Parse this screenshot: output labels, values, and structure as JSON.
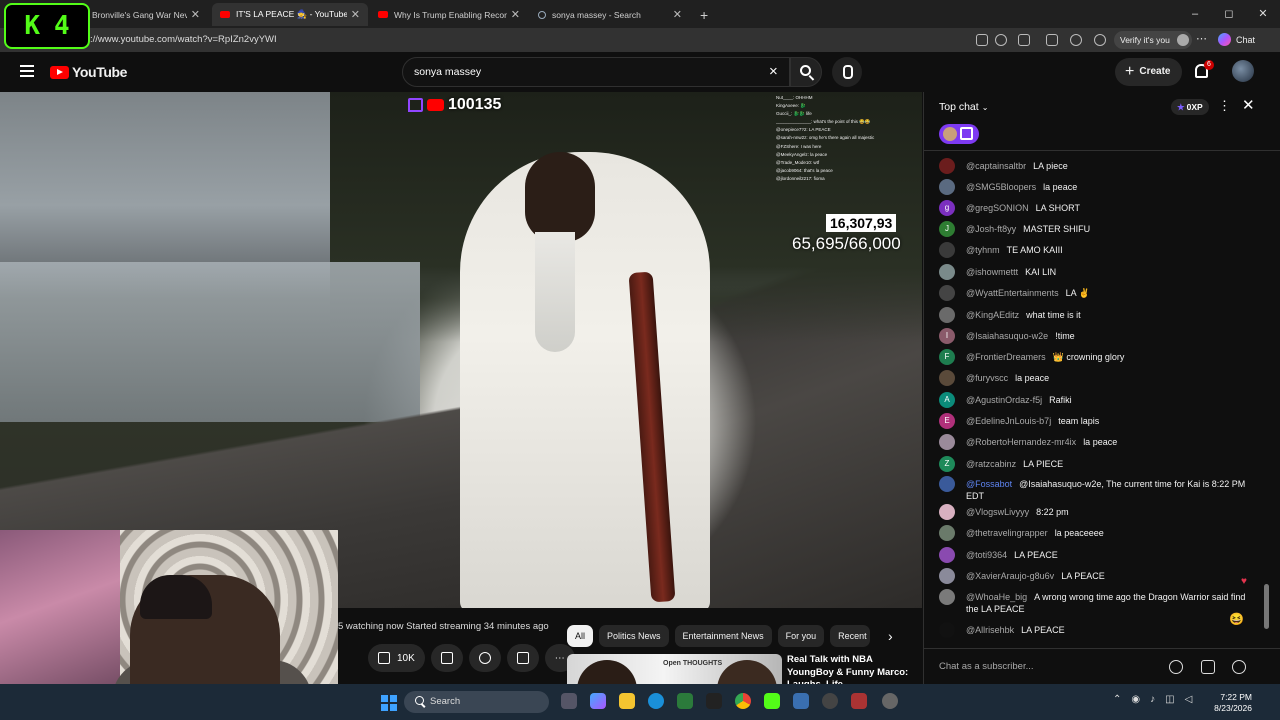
{
  "browser": {
    "kick_overlay": {
      "logo_letter": "K",
      "count": "4"
    },
    "tabs": [
      {
        "title": "Bronville's Gang War Never End",
        "kind": "tab"
      },
      {
        "title": "IT'S LA PEACE 🧙 - YouTube",
        "kind": "youtube",
        "active": true
      },
      {
        "title": "Why Is Trump Enabling Record Nu",
        "kind": "youtube"
      },
      {
        "title": "sonya massey - Search",
        "kind": "search"
      }
    ],
    "url": "://www.youtube.com/watch?v=RpIZn2vyYWI",
    "verify_label": "Verify it's you",
    "chat_label": "Chat",
    "window_controls": {
      "minimize": "–",
      "maximize": "◻",
      "close": "✕"
    }
  },
  "youtube": {
    "logo_text": "YouTube",
    "search": {
      "value": "sonya massey",
      "clear_icon": "×"
    },
    "create_label": "Create",
    "notification_count": "6"
  },
  "video": {
    "live_viewers": "100135",
    "overlay_chat": [
      "Nut____: OHHHM",
      "KingAxeee: 🐉",
      "Guccii_: 🐉🐉 life",
      "______________: what's the point of this 😂😂",
      "@onepiece7?2: LA PEACE",
      "@sarah-nnw2z: omg he's there again all majestic",
      "@FZShere: I was here",
      "@MeekyAngelz: la peace",
      "@Trade_Mode10: wtf",
      "@jacob9064: that's la peace",
      "@jlordonneil2217: fioma"
    ],
    "subscriber_count": "16,307,93",
    "goal_text": "65,695/66,000"
  },
  "below_video": {
    "stream_info": "5 watching now  Started streaming 34 minutes ago",
    "like_count": "10K",
    "chips": [
      {
        "label": "All",
        "active": true
      },
      {
        "label": "Politics News"
      },
      {
        "label": "Entertainment News"
      },
      {
        "label": "For you"
      },
      {
        "label": "Recent"
      }
    ],
    "chip_next": "›",
    "recommended": {
      "thumb_text": "Open THOUGHTS",
      "title": "Real Talk with NBA YoungBoy & Funny Marco: Laughs, Life, …"
    }
  },
  "chat": {
    "header": "Top chat",
    "xp_label": "0XP",
    "input_placeholder": "Chat as a subscriber...",
    "messages": [
      {
        "author": "@captainsaltbr",
        "text": "LA piece",
        "avatar": "",
        "color": "#6b1d1d"
      },
      {
        "author": "@SMG5Bloopers",
        "text": "la peace",
        "avatar": "",
        "color": "#5a6a80"
      },
      {
        "author": "@gregSONION",
        "text": "LA SHORT",
        "avatar": "g",
        "color": "#7b2fbf"
      },
      {
        "author": "@Josh-ft8yy",
        "text": "MASTER SHIFU",
        "avatar": "J",
        "color": "#2e7d32"
      },
      {
        "author": "@tyhnm",
        "text": "TE AMO KAIII",
        "avatar": "",
        "color": "#3a3a3a"
      },
      {
        "author": "@ishowmettt",
        "text": "KAI LIN",
        "avatar": "",
        "color": "#7a8a8a"
      },
      {
        "author": "@WyattEntertainments",
        "text": "LA ✌",
        "avatar": "",
        "color": "#444"
      },
      {
        "author": "@KingAEditz",
        "text": "what time is it",
        "avatar": "",
        "color": "#6a6a6a"
      },
      {
        "author": "@Isaiahasuquo-w2e",
        "text": "!time",
        "avatar": "I",
        "color": "#8a5a6a"
      },
      {
        "author": "@FrontierDreamers",
        "text": "👑 crowning glory",
        "avatar": "F",
        "color": "#1e7d4f"
      },
      {
        "author": "@furyvscc",
        "text": "la peace",
        "avatar": "",
        "color": "#5a4a3a"
      },
      {
        "author": "@AgustinOrdaz-f5j",
        "text": "Rafiki",
        "avatar": "A",
        "color": "#0b8b7a"
      },
      {
        "author": "@EdelineJnLouis-b7j",
        "text": "team lapis",
        "avatar": "E",
        "color": "#b0307a"
      },
      {
        "author": "@RobertoHernandez-mr4ix",
        "text": "la peace",
        "avatar": "",
        "color": "#9a8a9a"
      },
      {
        "author": "@ratzcabinz",
        "text": "LA PIECE",
        "avatar": "Z",
        "color": "#1e8a5a"
      },
      {
        "author": "@Fossabot",
        "text": "@Isaiahasuquo-w2e, The current time for Kai is 8:22 PM EDT",
        "avatar": "",
        "color": "#3a5a9a",
        "moderator": true
      },
      {
        "author": "@VlogswLivyyy",
        "text": "8:22 pm",
        "avatar": "",
        "color": "#d8b0c0"
      },
      {
        "author": "@thetravelingrapper",
        "text": "la peaceeee",
        "avatar": "",
        "color": "#6a7a6a"
      },
      {
        "author": "@toti9364",
        "text": "LA PEACE",
        "avatar": "",
        "color": "#8a4ab0"
      },
      {
        "author": "@XavierAraujo-g8u6v",
        "text": "LA PEACE",
        "avatar": "",
        "color": "#8a8a9a"
      },
      {
        "author": "@WhoaHe_big",
        "text": "A wrong wrong time ago the Dragon Warrior said find the LA PEACE",
        "avatar": "",
        "color": "#7a7a7a"
      },
      {
        "author": "@Allrisehbk",
        "text": "LA PEACE",
        "avatar": "",
        "color": "#111"
      }
    ]
  },
  "taskbar": {
    "search_label": "Search",
    "time": "7:22 PM",
    "date": "8/23/2026"
  },
  "colors": {
    "youtube_red": "#ff0000",
    "kick_green": "#53fc18",
    "twitch_purple": "#9146ff",
    "chat_bg": "#0f0f0f"
  }
}
